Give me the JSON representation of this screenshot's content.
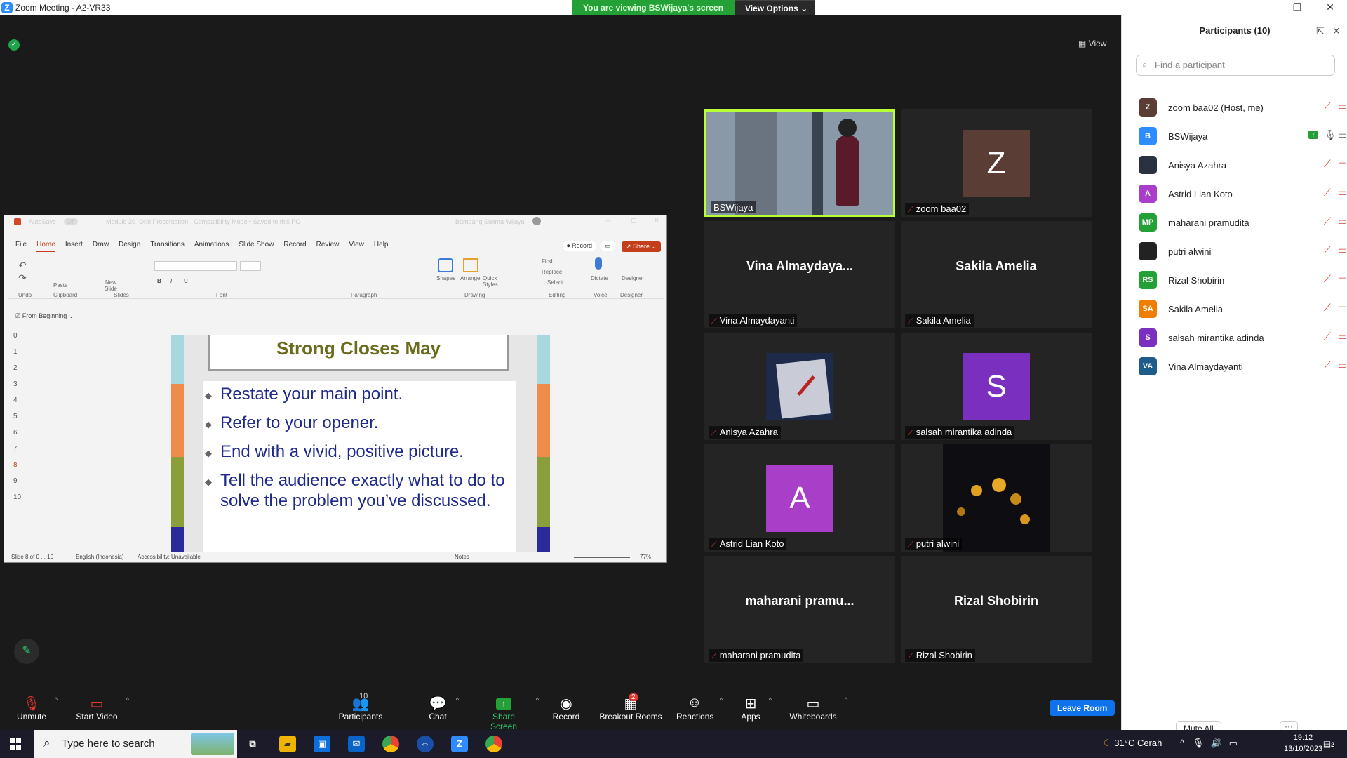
{
  "window": {
    "title": "Zoom Meeting - A2-VR33",
    "logo": "Z"
  },
  "banner": {
    "message": "You are viewing BSWijaya's screen",
    "view_options": "View Options"
  },
  "top_right_view": "View",
  "ppt": {
    "autosave": "AutoSave",
    "autosave_state": "Off",
    "file": "Module 20_Oral Presentation  -  Compatibility Mode  •  Saved to this PC",
    "user": "Bambang Sukma Wijaya",
    "menu": [
      "File",
      "Home",
      "Insert",
      "Draw",
      "Design",
      "Transitions",
      "Animations",
      "Slide Show",
      "Record",
      "Review",
      "View",
      "Help"
    ],
    "record_btn": "Record",
    "share_btn": "Share",
    "groups": [
      "Undo",
      "Clipboard",
      "Slides",
      "Font",
      "Paragraph",
      "Drawing",
      "Editing",
      "Voice",
      "Designer"
    ],
    "tools": [
      "Paste",
      "New Slide",
      "Shapes",
      "Arrange",
      "Quick Styles",
      "Find",
      "Replace",
      "Select",
      "Dictate",
      "Designer"
    ],
    "from_beginning": "From Beginning",
    "slide_numbers": [
      "0",
      "1",
      "2",
      "3",
      "4",
      "5",
      "6",
      "7",
      "8",
      "9",
      "10"
    ],
    "active_slide_index": 8,
    "slide_title": "Strong Closes May",
    "bullets": [
      "Restate your main point.",
      "Refer to your opener.",
      "End with a vivid, positive picture.",
      "Tell the audience exactly what to do to solve the problem you’ve discussed."
    ],
    "status_slide": "Slide 8 of 0 ... 10",
    "status_lang": "English (Indonesia)",
    "status_access": "Accessibility: Unavailable",
    "status_notes": "Notes",
    "zoom": "77%"
  },
  "gallery": [
    {
      "label": "BSWijaya",
      "type": "video",
      "speaking": true,
      "muted": false
    },
    {
      "label": "zoom baa02",
      "type": "avatar",
      "initials": "Z",
      "color": "#5a3e36",
      "muted": true
    },
    {
      "label": "Vina Almaydayanti",
      "type": "name",
      "big": "Vina  Almaydaya...",
      "muted": true
    },
    {
      "label": "Sakila Amelia",
      "type": "name",
      "big": "Sakila Amelia",
      "muted": true
    },
    {
      "label": "Anisya Azahra",
      "type": "photo",
      "muted": true
    },
    {
      "label": "salsah mirantika adinda",
      "type": "avatar",
      "initials": "S",
      "color": "#7b2fbf",
      "muted": true
    },
    {
      "label": "Astrid Lian Koto",
      "type": "avatar",
      "initials": "A",
      "color": "#a93fc9",
      "muted": true
    },
    {
      "label": "putri alwini",
      "type": "flower",
      "muted": true
    },
    {
      "label": "maharani pramudita",
      "type": "name",
      "big": "maharani  pramu...",
      "muted": true
    },
    {
      "label": "Rizal Shobirin",
      "type": "name",
      "big": "Rizal Shobirin",
      "muted": true
    }
  ],
  "participants": {
    "title": "Participants (10)",
    "search_placeholder": "Find a participant",
    "list": [
      {
        "initials": "Z",
        "name": "zoom baa02 (Host, me)",
        "color": "#5a3e36"
      },
      {
        "initials": "B",
        "name": "BSWijaya",
        "color": "#2d8cff",
        "sharing": true
      },
      {
        "initials": "",
        "name": "Anisya Azahra",
        "color": "#2a3140"
      },
      {
        "initials": "A",
        "name": "Astrid Lian Koto",
        "color": "#a93fc9"
      },
      {
        "initials": "MP",
        "name": "maharani pramudita",
        "color": "#23a036"
      },
      {
        "initials": "",
        "name": "putri alwini",
        "color": "#222222"
      },
      {
        "initials": "RS",
        "name": "Rizal Shobirin",
        "color": "#23a036"
      },
      {
        "initials": "SA",
        "name": "Sakila Amelia",
        "color": "#f07c00"
      },
      {
        "initials": "S",
        "name": "salsah mirantika adinda",
        "color": "#7b2fbf"
      },
      {
        "initials": "VA",
        "name": "Vina Almaydayanti",
        "color": "#1e5c8c"
      }
    ],
    "mute_all": "Mute All",
    "more": "···"
  },
  "toolbar": {
    "unmute": "Unmute",
    "start_video": "Start Video",
    "participants": "Participants",
    "participants_count": "10",
    "chat": "Chat",
    "share_screen": "Share Screen",
    "record": "Record",
    "breakout": "Breakout Rooms",
    "breakout_badge": "2",
    "reactions": "Reactions",
    "apps": "Apps",
    "whiteboards": "Whiteboards",
    "leave": "Leave Room"
  },
  "taskbar": {
    "search": "Type here to search",
    "weather": "31°C  Cerah",
    "time": "19:12",
    "date": "13/10/2023",
    "notif": "2"
  },
  "colors": {
    "speaking": "#b9ff35",
    "muted": "#e0382f",
    "zoom_blue": "#2d8cff",
    "banner": "#23a036"
  }
}
